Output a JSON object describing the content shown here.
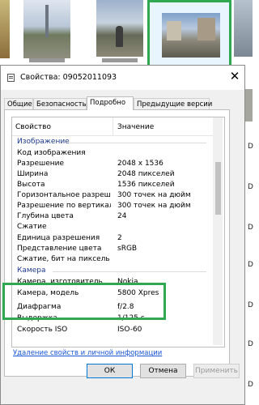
{
  "explorer": {
    "side_labels": [
      "D",
      "D",
      "D",
      "D",
      "D",
      "D",
      "D"
    ]
  },
  "dialog": {
    "title": "Свойства: 09052011093",
    "close_glyph": "✕",
    "tabs": [
      "Общие",
      "Безопасность",
      "Подробно",
      "Предыдущие версии"
    ],
    "active_tab": "Подробно",
    "columns": {
      "property": "Свойство",
      "value": "Значение"
    },
    "groups": [
      "Изображение",
      "Камера"
    ],
    "rows_image": [
      {
        "p": "Код изображения",
        "v": ""
      },
      {
        "p": "Разрешение",
        "v": "2048 x 1536"
      },
      {
        "p": "Ширина",
        "v": "2048 пикселей"
      },
      {
        "p": "Высота",
        "v": "1536 пикселей"
      },
      {
        "p": "Горизонтальное разреше...",
        "v": "300 точек на дюйм"
      },
      {
        "p": "Разрешение по вертикали",
        "v": "300 точек на дюйм"
      },
      {
        "p": "Глубина цвета",
        "v": "24"
      },
      {
        "p": "Сжатие",
        "v": ""
      },
      {
        "p": "Единица разрешения",
        "v": "2"
      },
      {
        "p": "Представление цвета",
        "v": "sRGB"
      },
      {
        "p": "Сжатие, бит на пиксель",
        "v": ""
      }
    ],
    "rows_camera": [
      {
        "p": "Камера, изготовитель",
        "v": "Nokia"
      },
      {
        "p": "Камера, модель",
        "v": "5800 Xpres"
      },
      {
        "p": "Диафрагма",
        "v": "f/2.8"
      },
      {
        "p": "Выдержка",
        "v": "1/125 с."
      },
      {
        "p": "Скорость ISO",
        "v": "ISO-60"
      }
    ],
    "remove_link": "Удаление свойств и личной информации",
    "buttons": {
      "ok": "ОК",
      "cancel": "Отмена",
      "apply": "Применить"
    }
  }
}
